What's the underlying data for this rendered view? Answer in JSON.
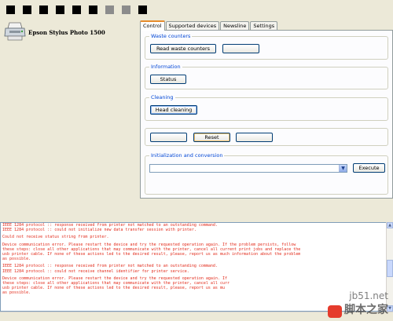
{
  "header": {
    "status_squares": [
      "black",
      "black",
      "black",
      "black",
      "black",
      "black",
      "gray",
      "gray",
      "black",
      "black",
      "black",
      "black",
      "black",
      "black",
      "black",
      "black"
    ]
  },
  "printer": {
    "name": "Epson Stylus Photo 1500",
    "icon": "printer-icon"
  },
  "tabs": [
    {
      "label": "Control",
      "active": true
    },
    {
      "label": "Supported devices",
      "active": false
    },
    {
      "label": "Newsline",
      "active": false
    },
    {
      "label": "Settings",
      "active": false
    }
  ],
  "control": {
    "waste_counters": {
      "title": "Waste counters",
      "read_label": "Read waste counters",
      "second_label": ""
    },
    "information": {
      "title": "Information",
      "status_label": "Status"
    },
    "cleaning": {
      "title": "Cleaning",
      "head_cleaning_label": "Head cleaning"
    },
    "actions": {
      "left_label": "",
      "reset_label": "Reset",
      "right_label": ""
    },
    "init": {
      "title": "Initialization and conversion",
      "select_value": "",
      "execute_label": "Execute"
    }
  },
  "log": {
    "lines": [
      "IEEE 1284 protocol :: response received from printer not matched to an outstanding command.",
      "IEEE 1284 protocol :: could not initialize new data transfer session with printer.",
      "",
      "Could not receive status string from printer.",
      "",
      "Device communication error. Please restart the device and try the requested operation again. If the problem persists, follow",
      "these steps: close all other applications that may communicate with the printer, cancel all current print jobs and replace the",
      "usb printer cable. If none of these actions led to the desired result, please, report us as much information about the problem",
      "as possible.",
      "",
      "IEEE 1284 protocol :: response received from printer not matched to an outstanding command.",
      "IEEE 1284 protocol :: could not receive channel identifier for printer service.",
      "",
      "Device communication error. Please restart the device and try the requested operation again. If",
      "these steps: close all other applications that may communicate with the printer, cancel all curr",
      "usb printer cable. If none of these actions led to the desired result, please, report us as mu",
      "as possible."
    ]
  },
  "watermark": {
    "url": "jb51.net",
    "text": "脚本之家"
  }
}
